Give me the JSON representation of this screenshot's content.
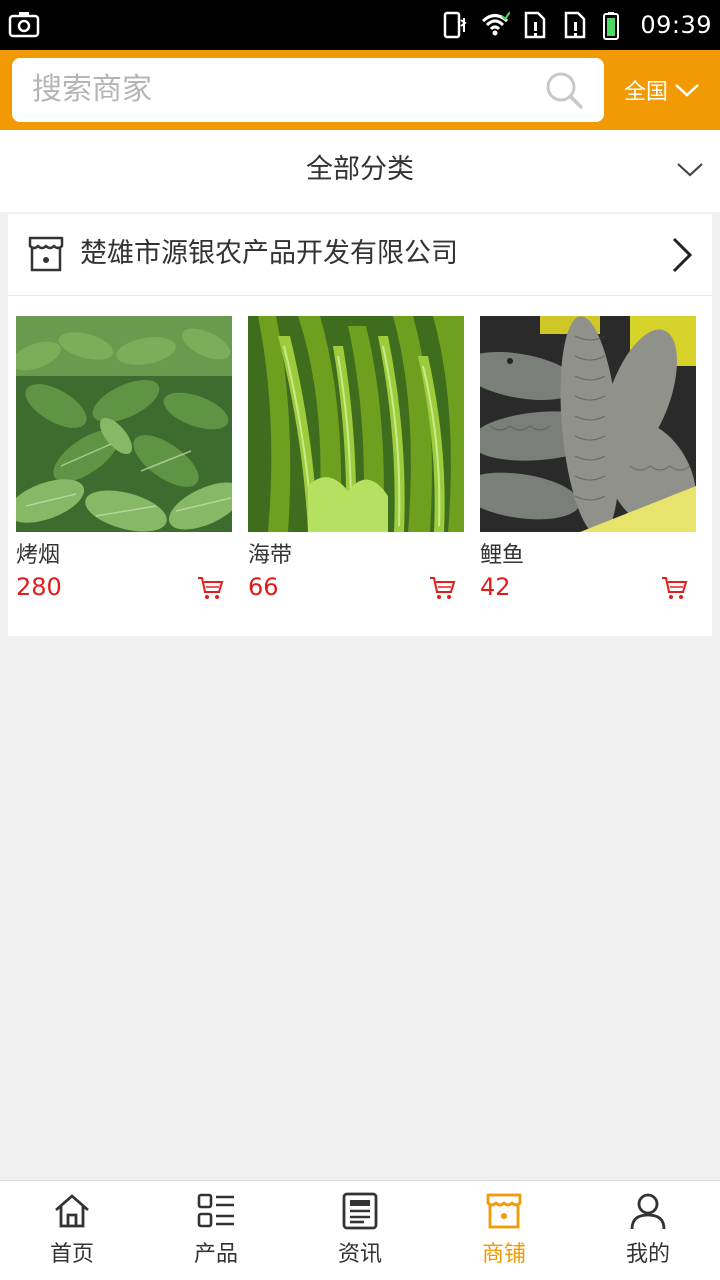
{
  "status_bar": {
    "time": "09:39",
    "icons": [
      "screenshot-icon",
      "vibrate-icon",
      "wifi-icon",
      "sim1-alert-icon",
      "sim2-alert-icon",
      "battery-icon"
    ]
  },
  "search": {
    "placeholder": "搜索商家",
    "region_label": "全国"
  },
  "category": {
    "label": "全部分类"
  },
  "store": {
    "name": "楚雄市源银农产品开发有限公司",
    "products": [
      {
        "name": "烤烟",
        "price": "280"
      },
      {
        "name": "海带",
        "price": "66"
      },
      {
        "name": "鲤鱼",
        "price": "42"
      }
    ]
  },
  "bottom_nav": [
    {
      "label": "首页",
      "icon": "home-icon",
      "active": false
    },
    {
      "label": "产品",
      "icon": "grid-list-icon",
      "active": false
    },
    {
      "label": "资讯",
      "icon": "news-icon",
      "active": false
    },
    {
      "label": "商铺",
      "icon": "store-icon",
      "active": true
    },
    {
      "label": "我的",
      "icon": "user-icon",
      "active": false
    }
  ],
  "colors": {
    "accent": "#f19a03",
    "price": "#e21b1b",
    "background": "#f0f0f0"
  }
}
